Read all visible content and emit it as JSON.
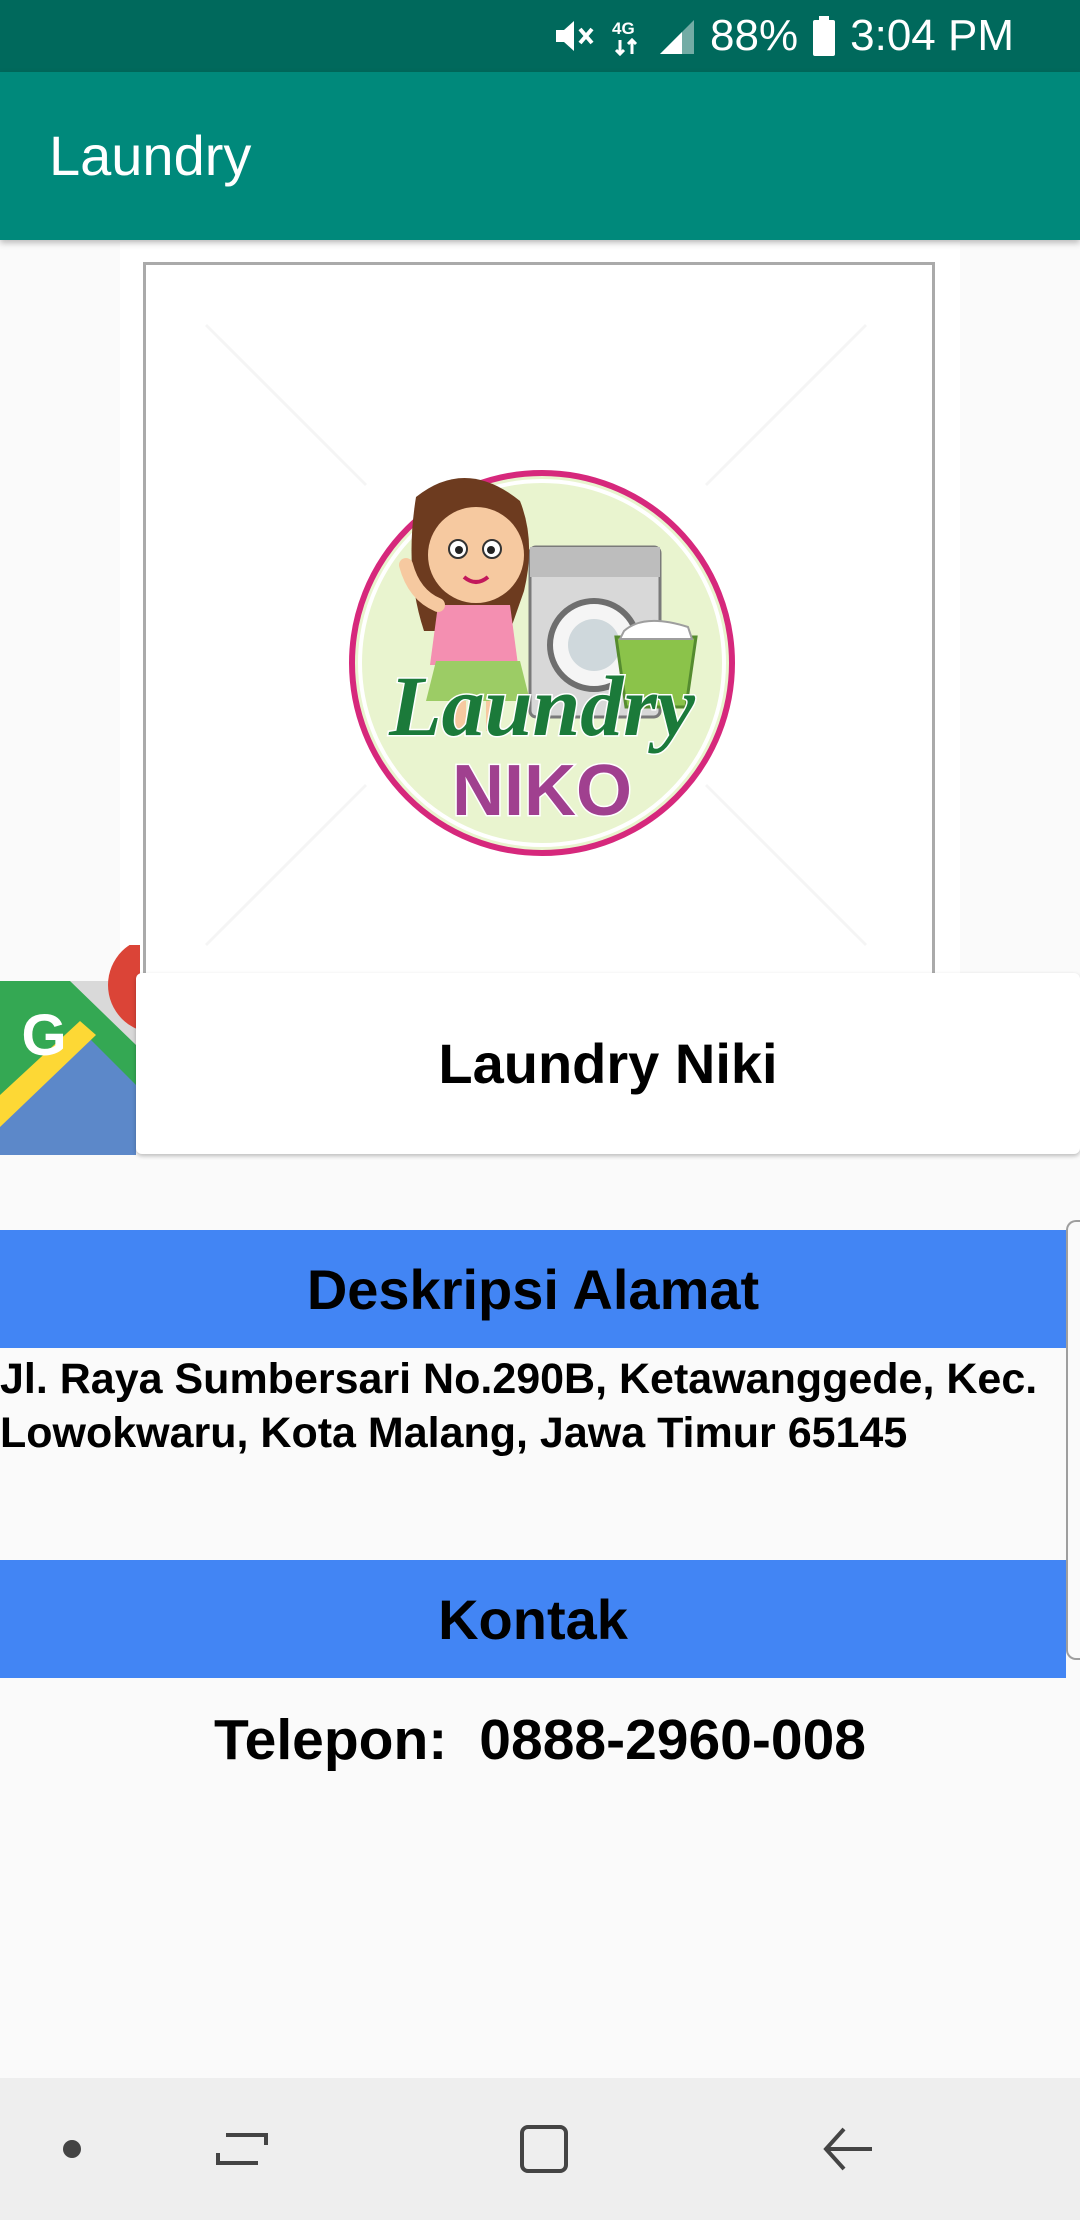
{
  "status_bar": {
    "battery_percent": "88%",
    "time": "3:04 PM",
    "network": "4G",
    "icons": [
      "mute-icon",
      "network-4g-icon",
      "signal-icon",
      "battery-icon"
    ]
  },
  "app_bar": {
    "title": "Laundry"
  },
  "logo": {
    "text_line1": "Laundry",
    "text_line2": "NIKO"
  },
  "laundry": {
    "name": "Laundry Niki"
  },
  "address_section": {
    "header": "Deskripsi Alamat",
    "text": "Jl. Raya Sumbersari No.290B, Ketawanggede, Kec. Lowokwaru, Kota Malang, Jawa Timur 65145"
  },
  "contact_section": {
    "header": "Kontak",
    "phone_label": "Telepon:",
    "phone_number": "0888-2960-008"
  },
  "nav_bar": {
    "icons": [
      "dot-icon",
      "recent-apps-icon",
      "home-icon",
      "back-icon"
    ]
  },
  "colors": {
    "status_bar": "#00695c",
    "app_bar": "#00897b",
    "section_header": "#4285f4"
  }
}
